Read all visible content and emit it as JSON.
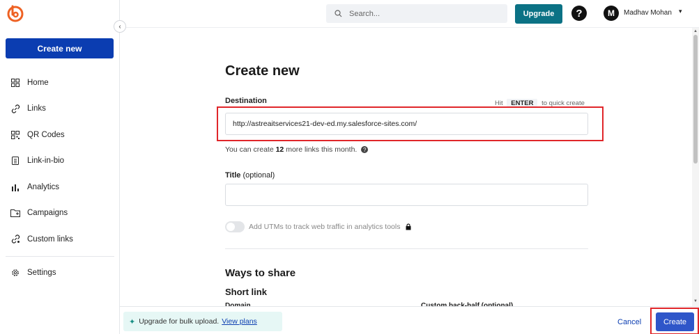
{
  "sidebar": {
    "create_label": "Create new",
    "collapse_icon": "chevron-left-icon",
    "items": [
      {
        "label": "Home",
        "icon": "home-icon"
      },
      {
        "label": "Links",
        "icon": "link-icon"
      },
      {
        "label": "QR Codes",
        "icon": "qr-code-icon"
      },
      {
        "label": "Link-in-bio",
        "icon": "page-icon"
      },
      {
        "label": "Analytics",
        "icon": "bar-chart-icon"
      },
      {
        "label": "Campaigns",
        "icon": "folder-icon"
      },
      {
        "label": "Custom links",
        "icon": "custom-link-icon"
      }
    ],
    "settings_label": "Settings"
  },
  "header": {
    "search_placeholder": "Search...",
    "upgrade_label": "Upgrade",
    "help_symbol": "?",
    "avatar_initial": "M",
    "username": "Madhav Mohan",
    "caret": "▾"
  },
  "form": {
    "title": "Create new",
    "destination_label": "Destination",
    "quick_prefix": "Hit",
    "quick_key": "ENTER",
    "quick_suffix": "to quick create",
    "destination_value": "http://astreaitservices21-dev-ed.my.salesforce-sites.com/",
    "remaining_prefix": "You can create",
    "remaining_count": "12",
    "remaining_suffix": "more links this month.",
    "title_label": "Title",
    "title_optional": "(optional)",
    "title_value": "",
    "utm_label": "Add UTMs to track web traffic in analytics tools",
    "share_title": "Ways to share",
    "short_link_title": "Short link",
    "domain_label": "Domain",
    "back_half_label": "Custom back-half (optional)"
  },
  "footer": {
    "bulk_text": "Upgrade for bulk upload.",
    "bulk_link": "View plans",
    "cancel_label": "Cancel",
    "create_label": "Create"
  },
  "colors": {
    "primary": "#0b3db1",
    "upgrade": "#0b7285",
    "highlight": "#e0262a",
    "create_button": "#2f56c9"
  }
}
